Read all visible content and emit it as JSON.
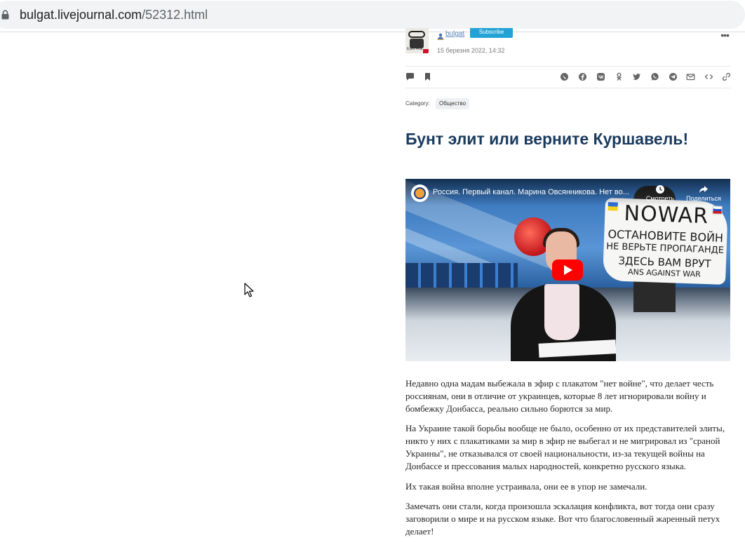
{
  "browser": {
    "url_host": "bulgat.livejournal.com",
    "url_path": "/52312.html"
  },
  "post": {
    "author": "bulgat",
    "avatar_tagline": "Eyes Fear",
    "subscribe_label": "Subscribe",
    "date": "15 березня 2022, 14:32",
    "category_label": "Category:",
    "category_value": "Общество",
    "title": "Бунт элит или верните Куршавель!"
  },
  "video": {
    "title": "Россия. Первый канал. Марина Овсянникова. Нет во...",
    "watch_later_label": "Смотреть",
    "share_label": "Поделиться",
    "poster_lines": [
      "NOWAR",
      "ОСТАНОВИТЕ ВОЙН",
      "НЕ ВЕРЬТЕ ПРОПАГАНДЕ",
      "ЗДЕСЬ ВАМ ВРУТ",
      "ANS AGAINST WAR"
    ]
  },
  "paragraphs": [
    "Недавно одна мадам выбежала в эфир с плакатом \"нет войне\", что делает честь россиянам, они в отличие от украинцев, которые 8 лет игнорировали войну и бомбежку Донбасса, реально сильно борются за мир.",
    "На Украине такой борьбы вообще не было, особенно от их представителей элиты, никто у них с плакатиками за мир в эфир не выбегал и не мигрировал из \"сраной Украины\", не отказывался от своей национальности, из-за текущей войны на Донбассе и прессования малых народностей, конкретно русского языка.",
    "Их такая война вполне устраивала, они ее в упор не замечали.",
    "Замечать они стали, когда произошла эскалация конфликта, вот тогда они сразу заговорили о мире и на русском языке. Вот что благословенный жаренный петух делает!"
  ],
  "colors": {
    "title": "#1a3a5f",
    "link": "#5788ba",
    "subscribe": "#23a3d5",
    "youtube_red": "#ff0000"
  }
}
